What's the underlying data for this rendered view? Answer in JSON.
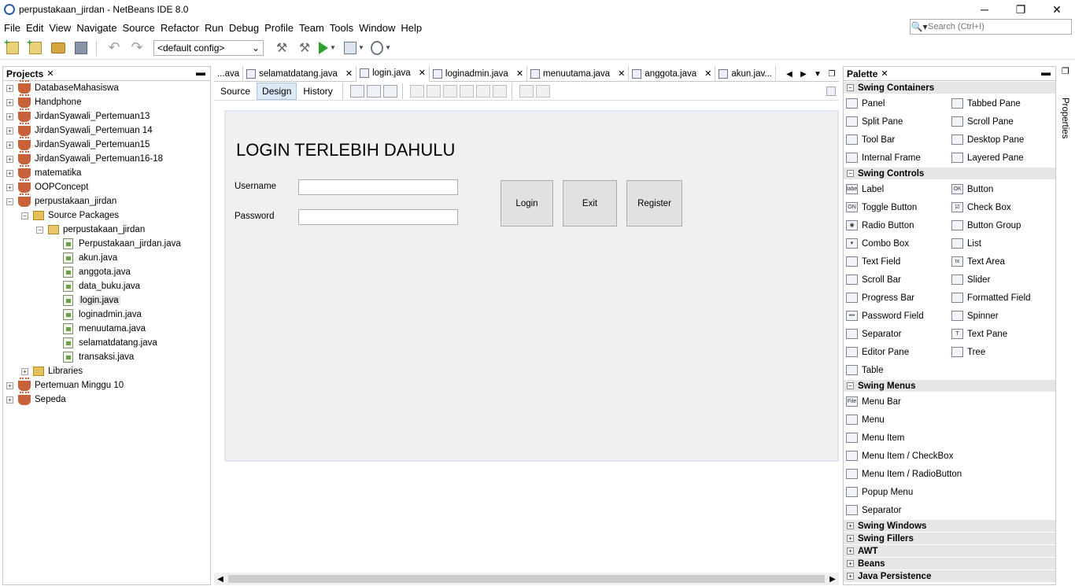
{
  "window": {
    "title": "perpustakaan_jirdan - NetBeans IDE 8.0",
    "controls": [
      "─",
      "❐",
      "✕"
    ]
  },
  "menu": [
    "File",
    "Edit",
    "View",
    "Navigate",
    "Source",
    "Refactor",
    "Run",
    "Debug",
    "Profile",
    "Team",
    "Tools",
    "Window",
    "Help"
  ],
  "search": {
    "placeholder": "Search (Ctrl+I)"
  },
  "toolbar": {
    "config": "<default config>"
  },
  "projects": {
    "title": "Projects",
    "items": [
      {
        "level": 0,
        "exp": "+",
        "icon": "cup",
        "label": "DatabaseMahasiswa"
      },
      {
        "level": 0,
        "exp": "+",
        "icon": "cup",
        "label": "Handphone"
      },
      {
        "level": 0,
        "exp": "+",
        "icon": "cup",
        "label": "JirdanSyawali_Pertemuan13"
      },
      {
        "level": 0,
        "exp": "+",
        "icon": "cup",
        "label": "JirdanSyawali_Pertemuan 14"
      },
      {
        "level": 0,
        "exp": "+",
        "icon": "cup",
        "label": "JirdanSyawali_Pertemuan15"
      },
      {
        "level": 0,
        "exp": "+",
        "icon": "cup",
        "label": "JirdanSyawali_Pertemuan16-18"
      },
      {
        "level": 0,
        "exp": "+",
        "icon": "cup",
        "label": "matematika"
      },
      {
        "level": 0,
        "exp": "+",
        "icon": "cup",
        "label": "OOPConcept"
      },
      {
        "level": 0,
        "exp": "−",
        "icon": "cup",
        "label": "perpustakaan_jirdan"
      },
      {
        "level": 1,
        "exp": "−",
        "icon": "pkgfolder",
        "label": "Source Packages"
      },
      {
        "level": 2,
        "exp": "−",
        "icon": "pkg",
        "label": "perpustakaan_jirdan"
      },
      {
        "level": 3,
        "exp": "",
        "icon": "jfile",
        "label": "Perpustakaan_jirdan.java"
      },
      {
        "level": 3,
        "exp": "",
        "icon": "jfile",
        "label": "akun.java"
      },
      {
        "level": 3,
        "exp": "",
        "icon": "jfile",
        "label": "anggota.java"
      },
      {
        "level": 3,
        "exp": "",
        "icon": "jfile",
        "label": "data_buku.java"
      },
      {
        "level": 3,
        "exp": "",
        "icon": "jfile",
        "label": "login.java",
        "selected": true
      },
      {
        "level": 3,
        "exp": "",
        "icon": "jfile",
        "label": "loginadmin.java"
      },
      {
        "level": 3,
        "exp": "",
        "icon": "jfile",
        "label": "menuutama.java"
      },
      {
        "level": 3,
        "exp": "",
        "icon": "jfile",
        "label": "selamatdatang.java"
      },
      {
        "level": 3,
        "exp": "",
        "icon": "jfile",
        "label": "transaksi.java"
      },
      {
        "level": 1,
        "exp": "+",
        "icon": "pkgfolder",
        "label": "Libraries"
      },
      {
        "level": 0,
        "exp": "+",
        "icon": "cup",
        "label": "Pertemuan Minggu 10"
      },
      {
        "level": 0,
        "exp": "+",
        "icon": "cup",
        "label": "Sepeda"
      }
    ]
  },
  "editor": {
    "tabs": [
      {
        "label": "...ava",
        "close": false
      },
      {
        "label": "selamatdatang.java",
        "close": true
      },
      {
        "label": "login.java",
        "close": true,
        "active": true
      },
      {
        "label": "loginadmin.java",
        "close": true
      },
      {
        "label": "menuutama.java",
        "close": true
      },
      {
        "label": "anggota.java",
        "close": true
      },
      {
        "label": "akun.jav...",
        "close": false
      }
    ],
    "views": [
      "Source",
      "Design",
      "History"
    ],
    "active_view": "Design"
  },
  "form": {
    "title": "LOGIN TERLEBIH DAHULU",
    "username_label": "Username",
    "password_label": "Password",
    "buttons": [
      "Login",
      "Exit",
      "Register"
    ]
  },
  "palette": {
    "title": "Palette",
    "categories": [
      {
        "name": "Swing Containers",
        "expanded": true,
        "columns": 2,
        "items": [
          {
            "label": "Panel",
            "icon": ""
          },
          {
            "label": "Tabbed Pane",
            "icon": ""
          },
          {
            "label": "Split Pane",
            "icon": ""
          },
          {
            "label": "Scroll Pane",
            "icon": ""
          },
          {
            "label": "Tool Bar",
            "icon": ""
          },
          {
            "label": "Desktop Pane",
            "icon": ""
          },
          {
            "label": "Internal Frame",
            "icon": ""
          },
          {
            "label": "Layered Pane",
            "icon": ""
          }
        ]
      },
      {
        "name": "Swing Controls",
        "expanded": true,
        "columns": 2,
        "items": [
          {
            "label": "Label",
            "icon": "label"
          },
          {
            "label": "Button",
            "icon": "OK"
          },
          {
            "label": "Toggle Button",
            "icon": "ON"
          },
          {
            "label": "Check Box",
            "icon": "☑"
          },
          {
            "label": "Radio Button",
            "icon": "◉"
          },
          {
            "label": "Button Group",
            "icon": ""
          },
          {
            "label": "Combo Box",
            "icon": "▾"
          },
          {
            "label": "List",
            "icon": ""
          },
          {
            "label": "Text Field",
            "icon": ""
          },
          {
            "label": "Text Area",
            "icon": "tx"
          },
          {
            "label": "Scroll Bar",
            "icon": ""
          },
          {
            "label": "Slider",
            "icon": ""
          },
          {
            "label": "Progress Bar",
            "icon": ""
          },
          {
            "label": "Formatted Field",
            "icon": ""
          },
          {
            "label": "Password Field",
            "icon": "•••"
          },
          {
            "label": "Spinner",
            "icon": ""
          },
          {
            "label": "Separator",
            "icon": ""
          },
          {
            "label": "Text Pane",
            "icon": "T"
          },
          {
            "label": "Editor Pane",
            "icon": ""
          },
          {
            "label": "Tree",
            "icon": ""
          },
          {
            "label": "Table",
            "icon": ""
          }
        ]
      },
      {
        "name": "Swing Menus",
        "expanded": true,
        "columns": 1,
        "items": [
          {
            "label": "Menu Bar",
            "icon": "File"
          },
          {
            "label": "Menu",
            "icon": ""
          },
          {
            "label": "Menu Item",
            "icon": ""
          },
          {
            "label": "Menu Item / CheckBox",
            "icon": ""
          },
          {
            "label": "Menu Item / RadioButton",
            "icon": ""
          },
          {
            "label": "Popup Menu",
            "icon": ""
          },
          {
            "label": "Separator",
            "icon": ""
          }
        ]
      },
      {
        "name": "Swing Windows",
        "expanded": false
      },
      {
        "name": "Swing Fillers",
        "expanded": false
      },
      {
        "name": "AWT",
        "expanded": false
      },
      {
        "name": "Beans",
        "expanded": false
      },
      {
        "name": "Java Persistence",
        "expanded": false
      }
    ]
  },
  "properties_tab": "Properties"
}
